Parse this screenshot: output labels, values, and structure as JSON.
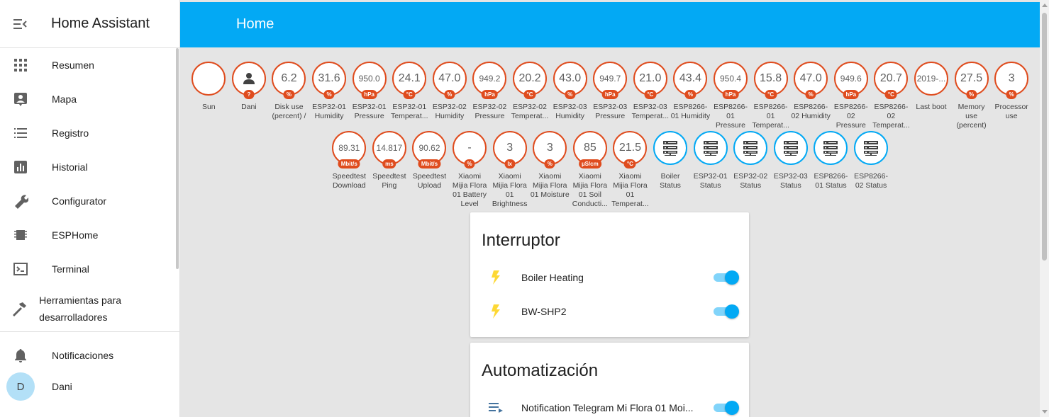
{
  "app": {
    "title": "Home Assistant"
  },
  "sidebar": {
    "items": [
      {
        "label": "Resumen",
        "icon": "grid-icon"
      },
      {
        "label": "Mapa",
        "icon": "account-box-icon"
      },
      {
        "label": "Registro",
        "icon": "list-icon"
      },
      {
        "label": "Historial",
        "icon": "chart-icon"
      },
      {
        "label": "Configurator",
        "icon": "wrench-icon"
      },
      {
        "label": "ESPHome",
        "icon": "chip-icon"
      },
      {
        "label": "Terminal",
        "icon": "terminal-icon"
      },
      {
        "label": "Herramientas para desarrolladores",
        "icon": "hammer-icon"
      }
    ],
    "notifications": "Notificaciones",
    "user": {
      "name": "Dani",
      "initial": "D"
    }
  },
  "header": {
    "title": "Home"
  },
  "badges_row1": [
    {
      "value": "",
      "unit": "",
      "label": "Sun",
      "kind": "moon"
    },
    {
      "value": "",
      "unit": "?",
      "label": "Dani",
      "kind": "person"
    },
    {
      "value": "6.2",
      "unit": "%",
      "label": "Disk use (percent) /"
    },
    {
      "value": "31.6",
      "unit": "%",
      "label": "ESP32-01 Humidity"
    },
    {
      "value": "950.0",
      "unit": "hPa",
      "label": "ESP32-01 Pressure",
      "small": true
    },
    {
      "value": "24.1",
      "unit": "°C",
      "label": "ESP32-01 Temperat..."
    },
    {
      "value": "47.0",
      "unit": "%",
      "label": "ESP32-02 Humidity"
    },
    {
      "value": "949.2",
      "unit": "hPa",
      "label": "ESP32-02 Pressure",
      "small": true
    },
    {
      "value": "20.2",
      "unit": "°C",
      "label": "ESP32-02 Temperat..."
    },
    {
      "value": "43.0",
      "unit": "%",
      "label": "ESP32-03 Humidity"
    },
    {
      "value": "949.7",
      "unit": "hPa",
      "label": "ESP32-03 Pressure",
      "small": true
    },
    {
      "value": "21.0",
      "unit": "°C",
      "label": "ESP32-03 Temperat..."
    },
    {
      "value": "43.4",
      "unit": "%",
      "label": "ESP8266-01 Humidity"
    },
    {
      "value": "950.4",
      "unit": "hPa",
      "label": "ESP8266-01 Pressure",
      "small": true
    },
    {
      "value": "15.8",
      "unit": "°C",
      "label": "ESP8266-01 Temperat..."
    },
    {
      "value": "47.0",
      "unit": "%",
      "label": "ESP8266-02 Humidity"
    },
    {
      "value": "949.6",
      "unit": "hPa",
      "label": "ESP8266-02 Pressure",
      "small": true
    },
    {
      "value": "20.7",
      "unit": "°C",
      "label": "ESP8266-02 Temperat..."
    },
    {
      "value": "2019-...",
      "unit": "",
      "label": "Last boot",
      "small": true
    },
    {
      "value": "27.5",
      "unit": "%",
      "label": "Memory use (percent)"
    },
    {
      "value": "3",
      "unit": "%",
      "label": "Processor use"
    }
  ],
  "badges_row2": [
    {
      "value": "89.31",
      "unit": "Mbit/s",
      "label": "Speedtest Download",
      "small": true
    },
    {
      "value": "14.817",
      "unit": "ms",
      "label": "Speedtest Ping",
      "small": true
    },
    {
      "value": "90.62",
      "unit": "Mbit/s",
      "label": "Speedtest Upload",
      "small": true
    },
    {
      "value": "-",
      "unit": "%",
      "label": "Xiaomi Mijia Flora 01 Battery Level"
    },
    {
      "value": "3",
      "unit": "lx",
      "label": "Xiaomi Mijia Flora 01 Brightness"
    },
    {
      "value": "3",
      "unit": "%",
      "label": "Xiaomi Mijia Flora 01 Moisture"
    },
    {
      "value": "85",
      "unit": "µS/cm",
      "label": "Xiaomi Mijia Flora 01 Soil Conducti..."
    },
    {
      "value": "21.5",
      "unit": "°C",
      "label": "Xiaomi Mijia Flora 01 Temperat..."
    },
    {
      "value": "",
      "unit": "",
      "label": "Boiler Status",
      "kind": "server"
    },
    {
      "value": "",
      "unit": "",
      "label": "ESP32-01 Status",
      "kind": "server"
    },
    {
      "value": "",
      "unit": "",
      "label": "ESP32-02 Status",
      "kind": "server"
    },
    {
      "value": "",
      "unit": "",
      "label": "ESP32-03 Status",
      "kind": "server"
    },
    {
      "value": "",
      "unit": "",
      "label": "ESP8266-01 Status",
      "kind": "server"
    },
    {
      "value": "",
      "unit": "",
      "label": "ESP8266-02 Status",
      "kind": "server"
    }
  ],
  "cards": {
    "interruptor": {
      "title": "Interruptor",
      "rows": [
        {
          "label": "Boiler Heating",
          "on": true
        },
        {
          "label": "BW-SHP2",
          "on": true
        }
      ]
    },
    "automatizacion": {
      "title": "Automatización",
      "rows": [
        {
          "label": "Notification Telegram Mi Flora 01 Moi...",
          "on": true
        }
      ]
    }
  },
  "colors": {
    "primary": "#03a9f4",
    "badge_border": "#df4c1e",
    "bolt": "#fdd835"
  }
}
